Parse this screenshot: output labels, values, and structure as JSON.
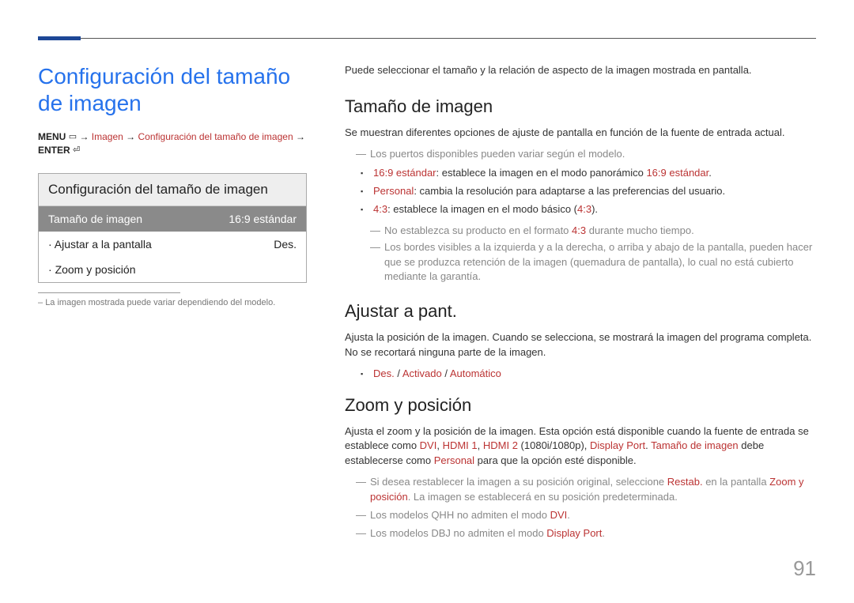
{
  "title": "Conﬁguración del tamaño de imagen",
  "breadcrumb": {
    "menu": "MENU",
    "path1": "Imagen",
    "path2": "Configuración del tamaño de imagen",
    "enter": "ENTER"
  },
  "panel": {
    "title": "Configuración del tamaño de imagen",
    "rows": [
      {
        "label": "Tamaño de imagen",
        "value": "16:9 estándar"
      },
      {
        "label": "Ajustar a la pantalla",
        "value": "Des."
      },
      {
        "label": "Zoom y posición",
        "value": ""
      }
    ]
  },
  "footnote": "La imagen mostrada puede variar dependiendo del modelo.",
  "intro": "Puede seleccionar el tamaño y la relación de aspecto de la imagen mostrada en pantalla.",
  "section1": {
    "heading": "Tamaño de imagen",
    "para": "Se muestran diferentes opciones de ajuste de pantalla en función de la fuente de entrada actual.",
    "note1": "Los puertos disponibles pueden variar según el modelo.",
    "b1_strong": "16:9 estándar",
    "b1_rest": ": establece la imagen en el modo panorámico ",
    "b1_strong2": "16:9 estándar",
    "b2_strong": "Personal",
    "b2_rest": ": cambia la resolución para adaptarse a las preferencias del usuario.",
    "b3_strong": "4:3",
    "b3_rest": ": establece la imagen en el modo básico (",
    "b3_strong2": "4:3",
    "b3_rest2": ").",
    "sn1a": "No establezca su producto en el formato ",
    "sn1b": "4:3",
    "sn1c": " durante mucho tiempo.",
    "sn2": "Los bordes visibles a la izquierda y a la derecha, o arriba y abajo de la pantalla, pueden hacer que se produzca retención de la imagen (quemadura de pantalla), lo cual no está cubierto mediante la garantía."
  },
  "section2": {
    "heading": "Ajustar a pant.",
    "para": "Ajusta la posición de la imagen. Cuando se selecciona, se mostrará la imagen del programa completa. No se recortará ninguna parte de la imagen.",
    "b1": "Des.",
    "b2": "Activado",
    "b3": "Automático"
  },
  "section3": {
    "heading": "Zoom y posición",
    "p1a": "Ajusta el zoom y la posición de la imagen. Esta opción está disponible cuando la fuente de entrada se establece como ",
    "p1_dvi": "DVI",
    "p1_h1": "HDMI 1",
    "p1_h2": "HDMI 2",
    "p1_res": " (1080i/1080p), ",
    "p1_dp": "Display Port",
    "p1_mid": ". ",
    "p1_ti": "Tamaño de imagen",
    "p1_mid2": " debe establecerse como ",
    "p1_pers": "Personal",
    "p1_end": " para que la opción esté disponible.",
    "n1a": "Si desea restablecer la imagen a su posición original, seleccione ",
    "n1_restab": "Restab.",
    "n1b": " en la pantalla ",
    "n1_zp": "Zoom y posición",
    "n1c": ". La imagen se establecerá en su posición predeterminada.",
    "n2a": "Los modelos QHH no admiten el modo ",
    "n2b": "DVI",
    "n3a": "Los modelos DBJ no admiten el modo ",
    "n3b": "Display Port"
  },
  "page": "91"
}
